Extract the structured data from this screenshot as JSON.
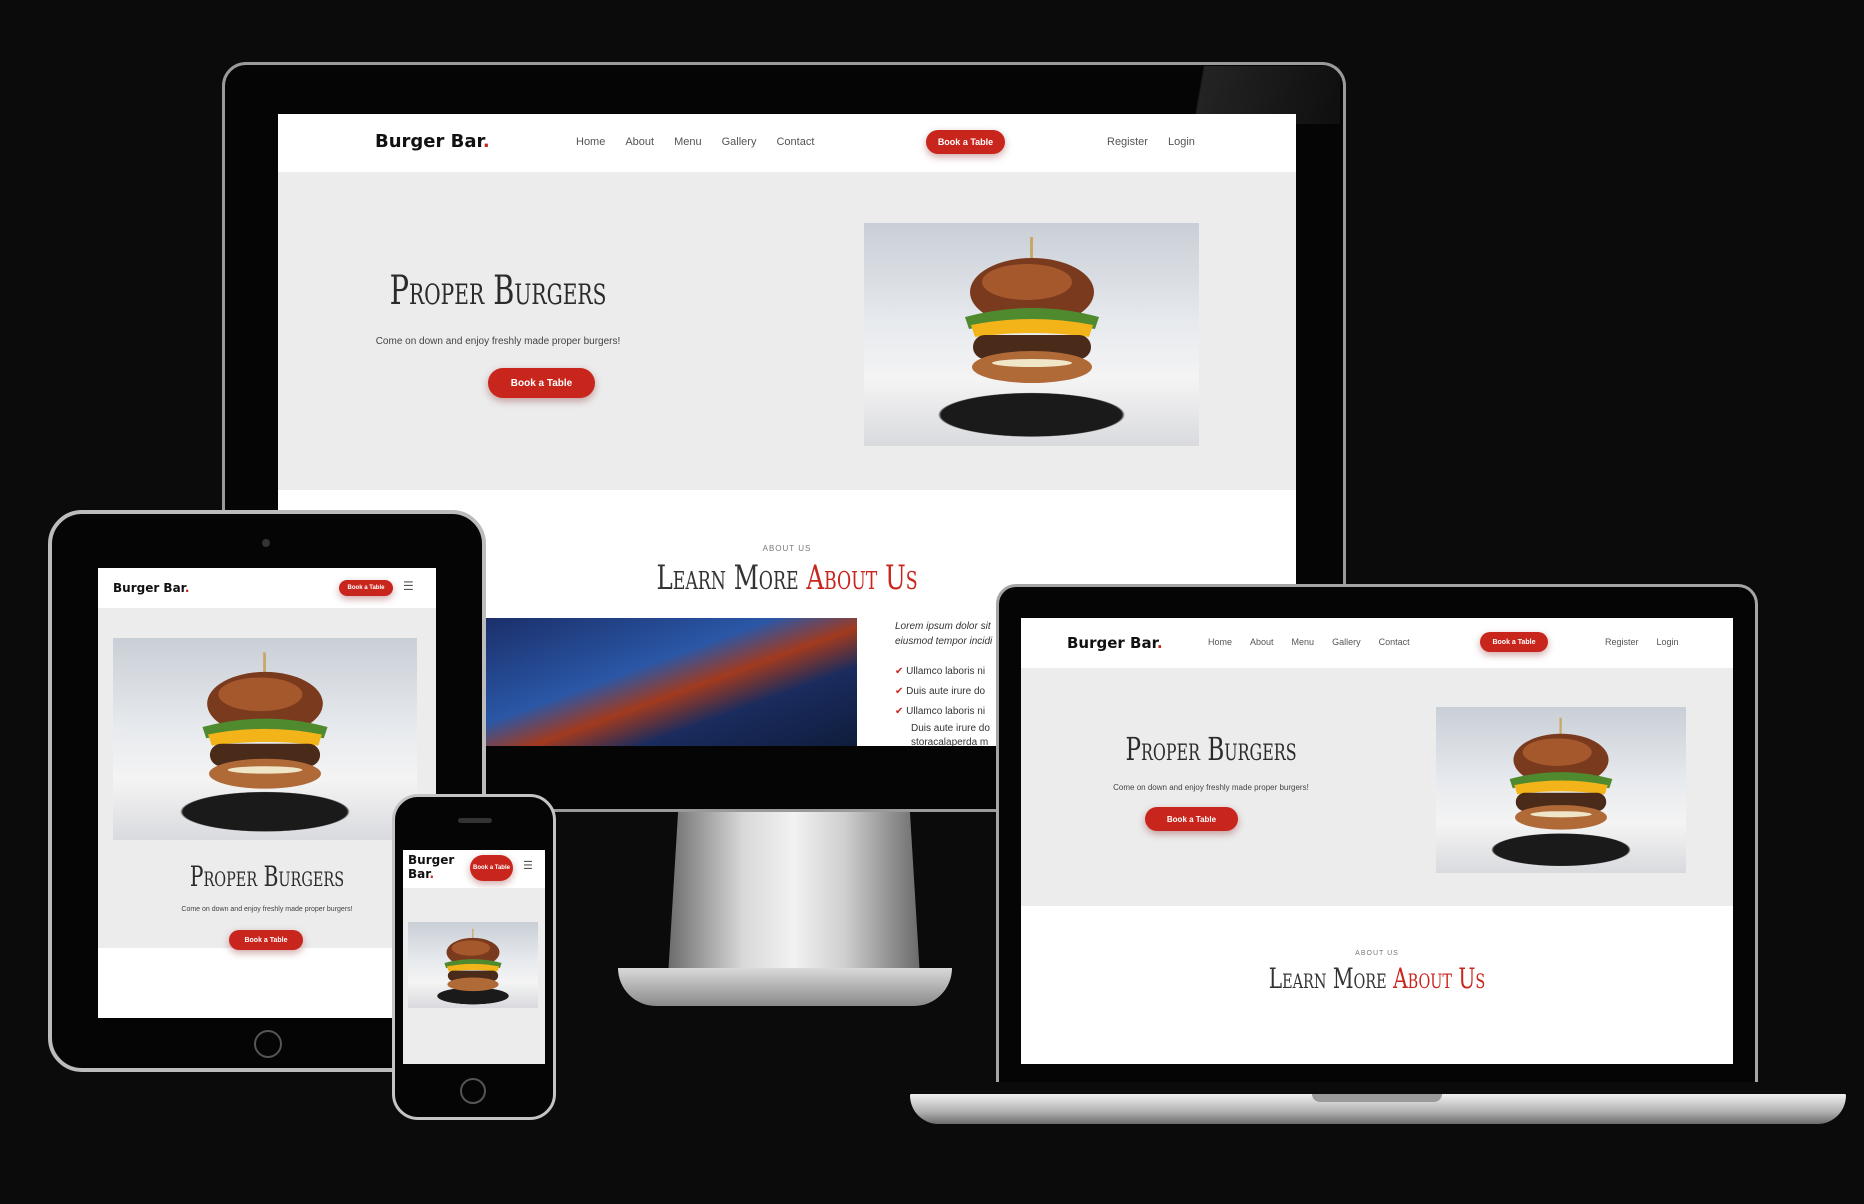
{
  "site": {
    "brand": "Burger Bar",
    "brand_dot": ".",
    "nav": {
      "home": "Home",
      "about": "About",
      "menu": "Menu",
      "gallery": "Gallery",
      "contact": "Contact"
    },
    "book_label": "Book a Table",
    "register_label": "Register",
    "login_label": "Login",
    "menu_icon": "hamburger-menu-icon"
  },
  "hero": {
    "title": "Proper Burgers",
    "subtitle": "Come on down and enjoy freshly made proper burgers!",
    "cta": "Book a Table"
  },
  "about": {
    "tag": "ABOUT US",
    "heading_part1": "Learn More",
    "heading_part2": "About Us",
    "intro": "Lorem ipsum dolor sit",
    "intro2": "eiusmod tempor incidi",
    "list": [
      "Ullamco laboris ni",
      "Duis aute irure do",
      "Ullamco laboris ni"
    ],
    "list_cont": [
      "Duis aute irure do",
      "storacalaperda m"
    ]
  },
  "colors": {
    "accent": "#c8261d",
    "hero_bg": "#ececec",
    "page_bg": "#0c0b0b"
  }
}
